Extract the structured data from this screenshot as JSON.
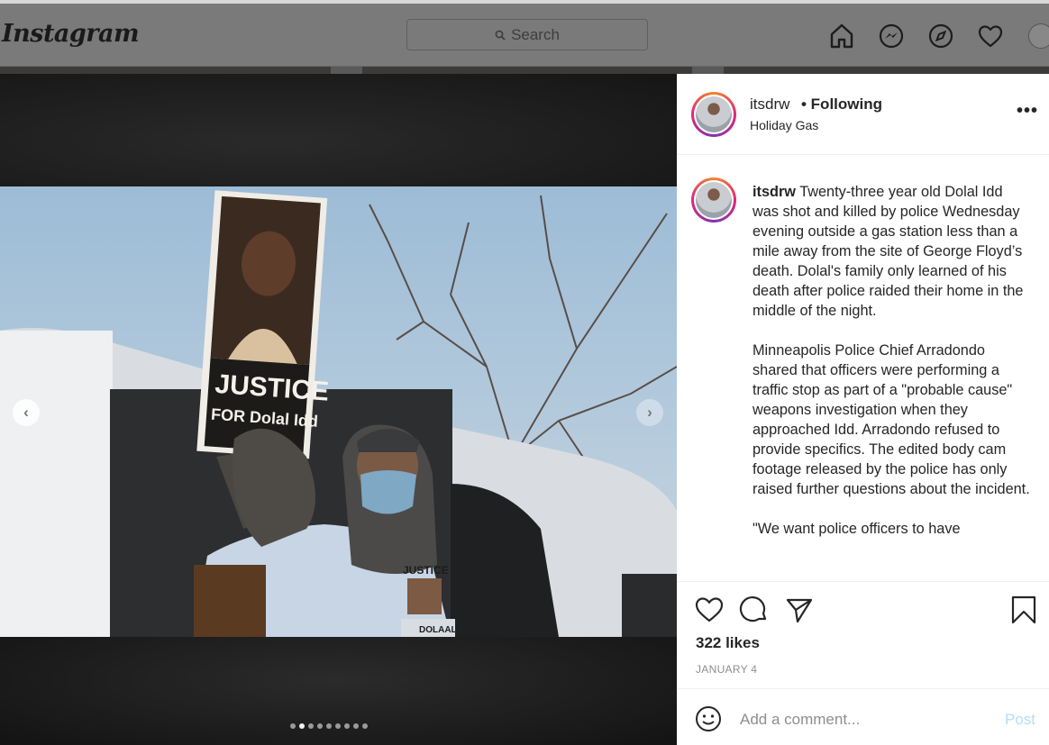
{
  "app": {
    "logo": "Instagram",
    "search_placeholder": "Search",
    "nav_icons": [
      "home-icon",
      "messenger-icon",
      "explore-icon",
      "activity-heart-icon",
      "profile-avatar"
    ]
  },
  "post": {
    "username": "itsdrw",
    "follow_status": "• Following",
    "location": "Holiday Gas",
    "more_label": "•••",
    "caption_user": "itsdrw",
    "caption_paragraphs": [
      "Twenty-three year old Dolal Idd was shot and killed by police Wednesday evening outside a gas station less than a mile away from the site of George Floyd’s death. Dolal's family only learned of his death after police raided their home in the middle of the night.",
      "Minneapolis Police Chief Arradondo shared that officers were performing a traffic stop as part of a \"probable cause\" weapons investigation when they approached Idd.  Arradondo refused to provide specifics. The edited body cam footage released by the police has only raised further questions about the incident.",
      "\"We want police officers to have"
    ],
    "likes": "322 likes",
    "date": "JANUARY 4",
    "comment_placeholder": "Add a comment...",
    "post_button": "Post",
    "carousel": {
      "total": 9,
      "active_index": 1
    },
    "photo_sign": {
      "line1": "JUSTICE",
      "line2": "FOR Dolal Idd"
    },
    "shirt_text": {
      "top": "JUSTICE",
      "bottom": "DOLAAL"
    }
  },
  "colors": {
    "accent_post": "#b2dffc",
    "text": "#262626",
    "muted": "#8e8e8e",
    "overlay_nav": "#7a7a7a"
  }
}
